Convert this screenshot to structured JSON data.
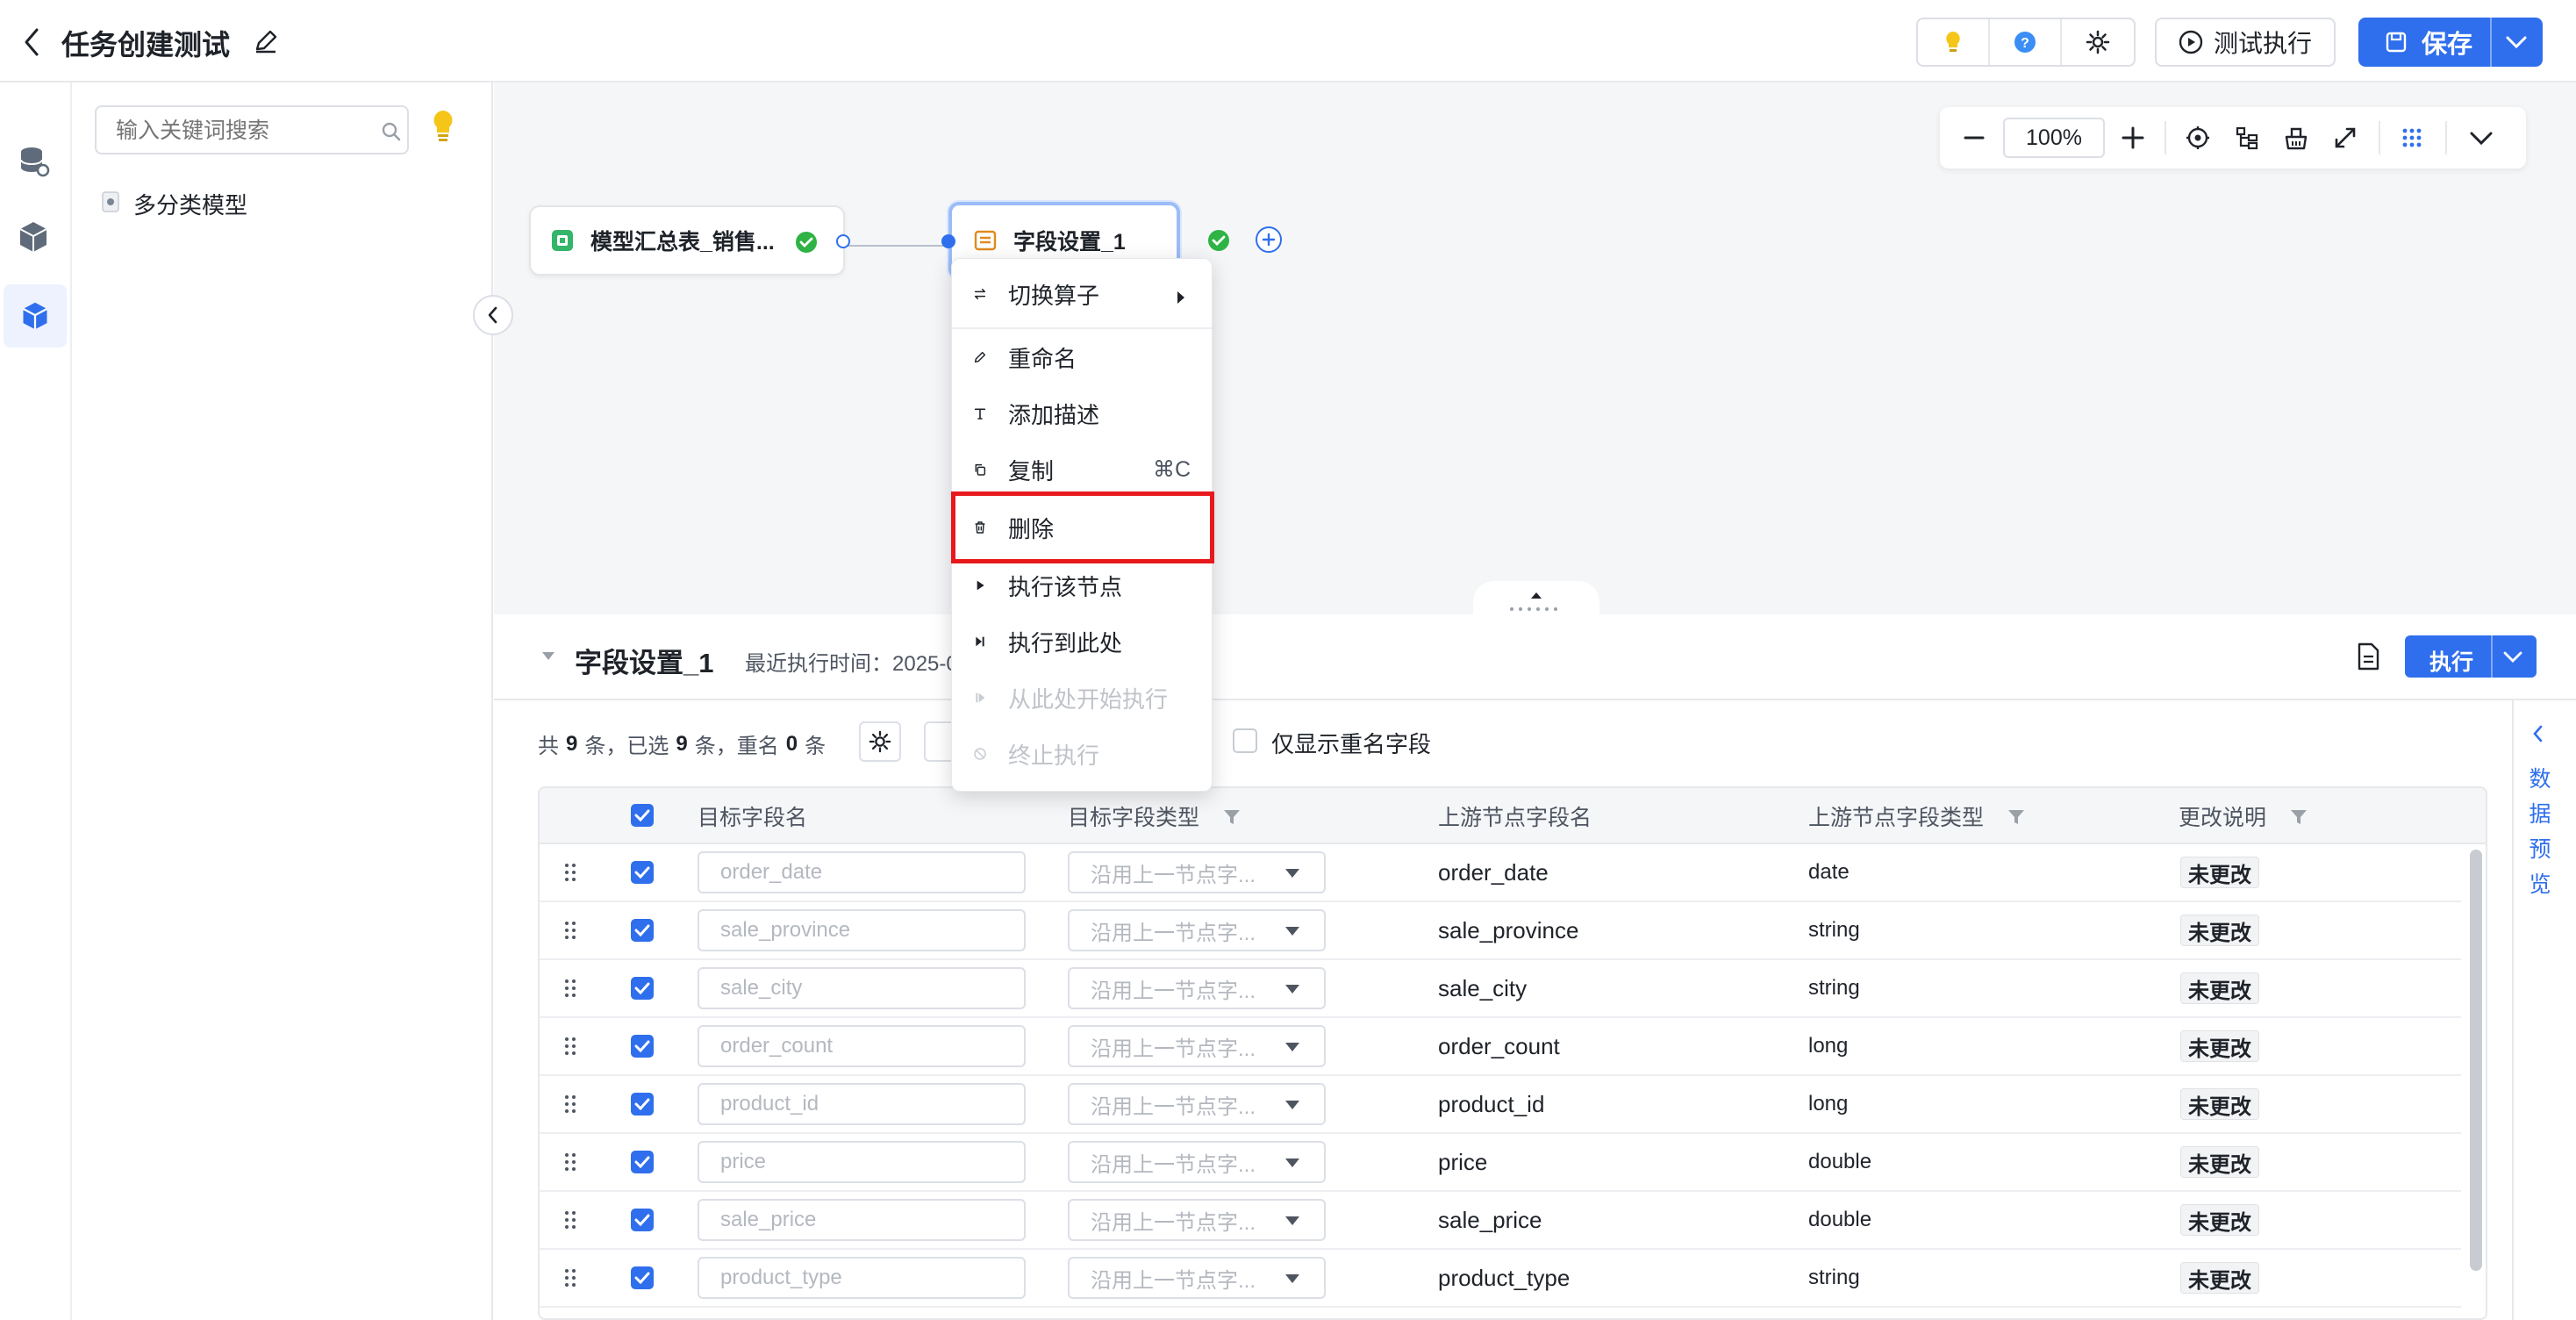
{
  "header": {
    "title": "任务创建测试",
    "test_run_label": "测试执行",
    "save_label": "保存"
  },
  "sidebar": {
    "search_placeholder": "输入关键词搜索",
    "tree_items": [
      {
        "label": "多分类模型"
      }
    ]
  },
  "canvas": {
    "zoom": "100%",
    "nodes": [
      {
        "label": "模型汇总表_销售...",
        "status": "success"
      },
      {
        "label": "字段设置_1",
        "status": "success",
        "selected": true
      }
    ]
  },
  "context_menu": {
    "items": [
      {
        "label": "切换算子",
        "icon": "switch-icon",
        "submenu": true
      },
      {
        "label": "重命名",
        "icon": "edit-icon"
      },
      {
        "label": "添加描述",
        "icon": "text-icon"
      },
      {
        "label": "复制",
        "icon": "copy-icon",
        "shortcut": "⌘C"
      },
      {
        "label": "删除",
        "icon": "trash-icon",
        "highlighted": true
      },
      {
        "label": "执行该节点",
        "icon": "play-icon"
      },
      {
        "label": "执行到此处",
        "icon": "play-to-icon"
      },
      {
        "label": "从此处开始执行",
        "icon": "play-from-icon",
        "disabled": true
      },
      {
        "label": "终止执行",
        "icon": "stop-icon",
        "disabled": true
      }
    ]
  },
  "panel": {
    "title": "字段设置_1",
    "last_run_label": "最近执行时间：2025-0",
    "run_label": "执行",
    "summary": {
      "prefix": "共",
      "total": "9",
      "mid1": "条，已选",
      "selected": "9",
      "mid2": "条，重名",
      "dup": "0",
      "suffix": "条"
    },
    "only_dup_label": "仅显示重名字段",
    "side_tab_chars": [
      "数",
      "据",
      "预",
      "览"
    ],
    "columns": [
      "目标字段名",
      "目标字段类型",
      "上游节点字段名",
      "上游节点字段类型",
      "更改说明"
    ],
    "rows": [
      {
        "target": "order_date",
        "type_placeholder": "沿用上一节点字...",
        "upstream": "order_date",
        "upstream_type": "date",
        "change": "未更改"
      },
      {
        "target": "sale_province",
        "type_placeholder": "沿用上一节点字...",
        "upstream": "sale_province",
        "upstream_type": "string",
        "change": "未更改"
      },
      {
        "target": "sale_city",
        "type_placeholder": "沿用上一节点字...",
        "upstream": "sale_city",
        "upstream_type": "string",
        "change": "未更改"
      },
      {
        "target": "order_count",
        "type_placeholder": "沿用上一节点字...",
        "upstream": "order_count",
        "upstream_type": "long",
        "change": "未更改"
      },
      {
        "target": "product_id",
        "type_placeholder": "沿用上一节点字...",
        "upstream": "product_id",
        "upstream_type": "long",
        "change": "未更改"
      },
      {
        "target": "price",
        "type_placeholder": "沿用上一节点字...",
        "upstream": "price",
        "upstream_type": "double",
        "change": "未更改"
      },
      {
        "target": "sale_price",
        "type_placeholder": "沿用上一节点字...",
        "upstream": "sale_price",
        "upstream_type": "double",
        "change": "未更改"
      },
      {
        "target": "product_type",
        "type_placeholder": "沿用上一节点字...",
        "upstream": "product_type",
        "upstream_type": "string",
        "change": "未更改"
      }
    ]
  },
  "colors": {
    "accent": "#2f6fed",
    "highlight": "#e8191c",
    "success": "#2fb344"
  }
}
